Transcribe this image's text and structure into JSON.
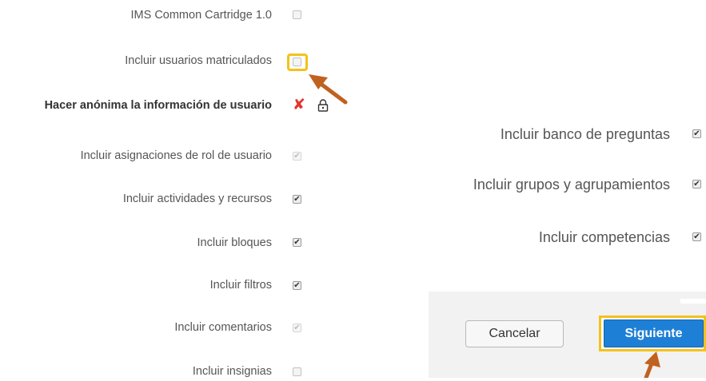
{
  "left_options": [
    {
      "label": "IMS Common Cartridge 1.0",
      "checked": false,
      "disabled": false
    },
    {
      "label": "Incluir usuarios matriculados",
      "checked": false,
      "disabled": false
    },
    {
      "label": "Hacer anónima la información de usuario",
      "bold": true
    },
    {
      "label": "Incluir asignaciones de rol de usuario",
      "checked": true,
      "disabled": true
    },
    {
      "label": "Incluir actividades y recursos",
      "checked": true,
      "disabled": false
    },
    {
      "label": "Incluir bloques",
      "checked": true,
      "disabled": false
    },
    {
      "label": "Incluir filtros",
      "checked": true,
      "disabled": false
    },
    {
      "label": "Incluir comentarios",
      "checked": true,
      "disabled": true
    },
    {
      "label": "Incluir insignias",
      "checked": false,
      "disabled": false
    }
  ],
  "right_options": [
    {
      "label": "Incluir banco de preguntas",
      "checked": true
    },
    {
      "label": "Incluir grupos y agrupamientos",
      "checked": true
    },
    {
      "label": "Incluir competencias",
      "checked": true
    }
  ],
  "icons": {
    "no_mark": "✘",
    "lock": "🔒",
    "check": "✔"
  },
  "buttons": {
    "cancel": "Cancelar",
    "next": "Siguiente"
  },
  "colors": {
    "highlight": "#f3c21b",
    "arrow": "#c0621f",
    "primary": "#1e7fd6",
    "cross": "#e3342f"
  }
}
